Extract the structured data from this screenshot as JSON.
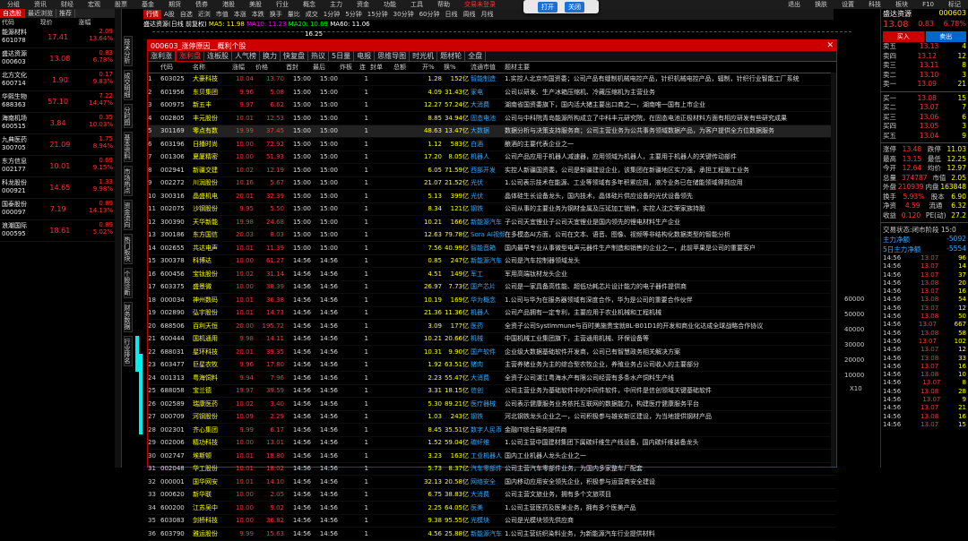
{
  "menubar": [
    "分组",
    "资讯",
    "财经",
    "宏观",
    "股票",
    "基金",
    "期货",
    "债券",
    "港股",
    "美股",
    "行业",
    "概念",
    "主力",
    "资金",
    "功能",
    "工具",
    "帮助"
  ],
  "menubar_alert": "交易未登录",
  "notify": {
    "open": "打开",
    "close": "关闭"
  },
  "top_right": [
    "退出",
    "换肤",
    "设置",
    "科技",
    "板块",
    "F10",
    "标记"
  ],
  "left": {
    "tabs": [
      "自选股",
      "最近浏览",
      "推荐"
    ],
    "header": [
      "代码",
      "现价",
      "涨幅"
    ],
    "rows": [
      {
        "name": "能源材料",
        "code": "601078",
        "price": "17.41",
        "chg": "2.09",
        "pct": "13.64%"
      },
      {
        "name": "盛达资源",
        "code": "000603",
        "price": "13.08",
        "chg": "0.83",
        "pct": "6.78%"
      },
      {
        "name": "北方文化",
        "code": "600714",
        "price": "1.90",
        "chg": "0.17",
        "pct": "9.83%"
      },
      {
        "name": "华熙生物",
        "code": "688363",
        "price": "57.10",
        "chg": "7.22",
        "pct": "14.47%"
      },
      {
        "name": "海南机场",
        "code": "600515",
        "price": "3.84",
        "chg": "0.35",
        "pct": "10.03%"
      },
      {
        "name": "九典医药",
        "code": "300705",
        "price": "21.09",
        "chg": "1.75",
        "pct": "8.94%"
      },
      {
        "name": "东方信息",
        "code": "002177",
        "price": "10.01",
        "chg": "0.69",
        "pct": "9.15%"
      },
      {
        "name": "科龙股份",
        "code": "000921",
        "price": "14.65",
        "chg": "1.33",
        "pct": "9.98%"
      },
      {
        "name": "国泰股份",
        "code": "000097",
        "price": "7.19",
        "chg": "0.89",
        "pct": "14.13%"
      },
      {
        "name": "浪潮国际",
        "code": "000595",
        "price": "18.61",
        "chg": "0.89",
        "pct": "5.02%"
      }
    ]
  },
  "vtabs": [
    "技术分析",
    "成交明细",
    "分时图",
    "基本资料",
    "市场热点",
    "资金流向",
    "热门板块",
    "个股诊断",
    "财务数据",
    "行业排名"
  ],
  "toolbar": [
    "行情",
    "A股",
    "自选",
    "近浏",
    "市值",
    "本涨",
    "本跌",
    "换手",
    "量比",
    "成交",
    "1分钟",
    "5分钟",
    "15分钟",
    "30分钟",
    "60分钟",
    "日线",
    "周线",
    "月线"
  ],
  "chartinfo": {
    "a": "盛达资源(日线 前复权)",
    "b": "MA5: 11.98",
    "c": "MA10: 11.23",
    "d": "MA20: 10.69",
    "e": "MA60: 11.06"
  },
  "priceline_label": "16.25",
  "axis_labels": [
    "60000",
    "50000",
    "40000",
    "30000",
    "20000",
    "10000"
  ],
  "axis_label_x10": "X10",
  "dialog": {
    "title": "000603_涨停原因__概利个股",
    "tabs": [
      "涨利涨",
      "涨利盘",
      "连板股",
      "人气榜",
      "换力",
      "快复盘",
      "热议",
      "5日量",
      "电报",
      "思维导图",
      "时光机",
      "题材轮",
      "全盘"
    ],
    "columns": [
      "代码",
      "名称",
      "涨幅",
      "价格",
      "首封",
      "最后",
      "炸板",
      "连",
      "封单",
      "总额",
      "开%",
      "换%",
      "流通市值",
      "题材主要"
    ],
    "rows": [
      {
        "no": "1",
        "code": "603025",
        "name": "大豪科技",
        "pct": "10.04",
        "price": "13.70",
        "t1": "15:00",
        "t2": "15:00",
        "zb": "",
        "lb": "1",
        "fd": "",
        "ze": "",
        "ok": "1.28",
        "hs": "152亿",
        "lt": "智能制造",
        "desc": "1.实控人北京市国资委；公司产品有缝制机械电控产品，针织机械电控产品，辐制，针织行业智能工厂系统"
      },
      {
        "no": "2",
        "code": "601956",
        "name": "东贝集团",
        "pct": "9.96",
        "price": "5.08",
        "t1": "15:00",
        "t2": "15:00",
        "zb": "",
        "lb": "1",
        "fd": "",
        "ze": "",
        "ok": "4.09",
        "hs": "31.43亿",
        "lt": "家电",
        "desc": "公司以研发、生产冰箱压缩机、冷藏压缩机为主营业务"
      },
      {
        "no": "3",
        "code": "600975",
        "name": "新五丰",
        "pct": "9.97",
        "price": "6.62",
        "t1": "15:00",
        "t2": "15:00",
        "zb": "",
        "lb": "1",
        "fd": "",
        "ze": "",
        "ok": "12.27",
        "hs": "57.24亿",
        "lt": "大消费",
        "desc": "湖南省国资委旗下，国内活大猪主要出口商之一，湖南唯一国有上市企业"
      },
      {
        "no": "4",
        "code": "002805",
        "name": "丰元股份",
        "pct": "10.01",
        "price": "12.53",
        "t1": "15:00",
        "t2": "15:00",
        "zb": "",
        "lb": "1",
        "fd": "",
        "ze": "",
        "ok": "8.85",
        "hs": "34.94亿",
        "lt": "固态电池",
        "desc": "公司与中科院青岛能源所构成立了中科丰元研究院，在固态电池正极材料方面有相应研发有些研究成果"
      },
      {
        "no": "5",
        "code": "301169",
        "name": "零点有数",
        "pct": "19.99",
        "price": "37.45",
        "t1": "15:00",
        "t2": "15:00",
        "zb": "",
        "lb": "1",
        "fd": "",
        "ze": "",
        "ok": "48.63",
        "hs": "13.47亿",
        "lt": "大数据",
        "desc": "数据分析与决策支持服务商；公司主营业务为公共事务领域数据产品，为客户提供全方位数据服务"
      },
      {
        "no": "6",
        "code": "603196",
        "name": "日播时尚",
        "pct": "10.00",
        "price": "72.92",
        "t1": "15:00",
        "t2": "15:00",
        "zb": "",
        "lb": "1",
        "fd": "",
        "ze": "",
        "ok": "1.12",
        "hs": "583亿",
        "lt": "白酒",
        "desc": "酿酒的主要代表企业之一"
      },
      {
        "no": "7",
        "code": "001306",
        "name": "夏厦精密",
        "pct": "10.00",
        "price": "51.93",
        "t1": "15:00",
        "t2": "15:00",
        "zb": "",
        "lb": "1",
        "fd": "",
        "ze": "",
        "ok": "17.20",
        "hs": "8.05亿",
        "lt": "机器人",
        "desc": "公司产品应用于机器人减速器，应用领域为机器人，主要用于机器人的关键传动部件"
      },
      {
        "no": "8",
        "code": "002941",
        "name": "新疆交建",
        "pct": "10.02",
        "price": "12.19",
        "t1": "15:00",
        "t2": "15:00",
        "zb": "",
        "lb": "1",
        "fd": "",
        "ze": "",
        "ok": "6.05",
        "hs": "71.59亿",
        "lt": "西部开发",
        "desc": "实控人新疆国资委，公司是新疆建设企业，该集团在新疆地区实力强，承担工程施工业务"
      },
      {
        "no": "9",
        "code": "002272",
        "name": "川润股份",
        "pct": "10.16",
        "price": "5.67",
        "t1": "15:00",
        "t2": "15:00",
        "zb": "",
        "lb": "1",
        "fd": "",
        "ze": "",
        "ok": "21.07",
        "hs": "21.52亿",
        "lt": "光伏",
        "desc": "1.公司表示技术在能源、工业等领域有多年积累应用，液冷业务已在储能领域得到应用"
      },
      {
        "no": "10",
        "code": "300316",
        "name": "晶盛机电",
        "pct": "20.01",
        "price": "32.39",
        "t1": "15:00",
        "t2": "15:00",
        "zb": "",
        "lb": "1",
        "fd": "",
        "ze": "",
        "ok": "5.13",
        "hs": "399亿",
        "lt": "光伏",
        "desc": "晶体硅生长设备龙头，国内技术，晶体硅片供应设备的光伏设备领先"
      },
      {
        "no": "11",
        "code": "002075",
        "name": "沙钢股份",
        "pct": "9.95",
        "price": "5.50",
        "t1": "15:00",
        "t2": "15:00",
        "zb": "",
        "lb": "1",
        "fd": "",
        "ze": "",
        "ok": "8.34",
        "hs": "121亿",
        "lt": "钢铁",
        "desc": "公司从事的主要业务为钢材金属及压延加工销售，实控人沈文荣家族持股"
      },
      {
        "no": "12",
        "code": "300390",
        "name": "天华新能",
        "pct": "19.98",
        "price": "24.68",
        "t1": "15:00",
        "t2": "15:00",
        "zb": "",
        "lb": "1",
        "fd": "",
        "ze": "",
        "ok": "10.21",
        "hs": "166亿",
        "lt": "新能源汽车",
        "desc": "子公司天宜锂业子公司天宜锂业是国内领先的锂电材料生产企业"
      },
      {
        "no": "13",
        "code": "300186",
        "name": "东方国信",
        "pct": "20.03",
        "price": "8.03",
        "t1": "15:00",
        "t2": "15:00",
        "zb": "",
        "lb": "1",
        "fd": "",
        "ze": "",
        "ok": "12.63",
        "hs": "79.78亿",
        "lt": "Sora AI视频",
        "desc": "在多模态AI方面，公司在文本、语音、图像、视频等非结构化数据类型的智能分析"
      },
      {
        "no": "14",
        "code": "002655",
        "name": "共达电声",
        "pct": "10.01",
        "price": "11.39",
        "t1": "15:00",
        "t2": "15:00",
        "zb": "",
        "lb": "1",
        "fd": "",
        "ze": "",
        "ok": "7.56",
        "hs": "40.99亿",
        "lt": "智能音箱",
        "desc": "国内最早专业从事微型电声元器件生产制造和销售的企业之一，此前苹果是公司的重要客户"
      },
      {
        "no": "15",
        "code": "300378",
        "name": "科博达",
        "pct": "10.00",
        "price": "61.27",
        "t1": "14:56",
        "t2": "14:56",
        "zb": "",
        "lb": "1",
        "fd": "",
        "ze": "",
        "ok": "0.85",
        "hs": "247亿",
        "lt": "新能源汽车",
        "desc": "公司是汽车控制器领域龙头"
      },
      {
        "no": "16",
        "code": "600456",
        "name": "宝钛股份",
        "pct": "10.02",
        "price": "31.14",
        "t1": "14:56",
        "t2": "14:56",
        "zb": "",
        "lb": "1",
        "fd": "",
        "ze": "",
        "ok": "4.51",
        "hs": "149亿",
        "lt": "军工",
        "desc": "军用高端钛材龙头企业"
      },
      {
        "no": "17",
        "code": "603375",
        "name": "盛景微",
        "pct": "10.00",
        "price": "38.39",
        "t1": "14:56",
        "t2": "14:56",
        "zb": "",
        "lb": "1",
        "fd": "",
        "ze": "",
        "ok": "26.97",
        "hs": "7.73亿",
        "lt": "国产芯片",
        "desc": "公司是一家具备高性能、超低功耗芯片设计能力的电子器件提供商"
      },
      {
        "no": "18",
        "code": "000034",
        "name": "神州数码",
        "pct": "10.01",
        "price": "36.38",
        "t1": "14:56",
        "t2": "14:56",
        "zb": "",
        "lb": "1",
        "fd": "",
        "ze": "",
        "ok": "10.19",
        "hs": "169亿",
        "lt": "华为概念",
        "desc": "1.公司与华为在服务器领域有深度合作，华为是公司的重要合作伙伴"
      },
      {
        "no": "19",
        "code": "002890",
        "name": "弘宇股份",
        "pct": "10.01",
        "price": "14.73",
        "t1": "14:56",
        "t2": "14:56",
        "zb": "",
        "lb": "1",
        "fd": "",
        "ze": "",
        "ok": "21.36",
        "hs": "11.36亿",
        "lt": "机器人",
        "desc": "公司产品拥有一定专利，主要应用于农业机械和工程机械"
      },
      {
        "no": "20",
        "code": "688506",
        "name": "百利天恒",
        "pct": "20.00",
        "price": "195.72",
        "t1": "14:56",
        "t2": "14:56",
        "zb": "",
        "lb": "1",
        "fd": "",
        "ze": "",
        "ok": "3.09",
        "hs": "177亿",
        "lt": "医药",
        "desc": "全资子公司SystImmune与百时美施贵宝就BL-B01D1的开发和商业化达成全球战略合作协议"
      },
      {
        "no": "21",
        "code": "600444",
        "name": "国机通用",
        "pct": "9.98",
        "price": "14.11",
        "t1": "14:56",
        "t2": "14:56",
        "zb": "",
        "lb": "1",
        "fd": "",
        "ze": "",
        "ok": "10.21",
        "hs": "20.66亿",
        "lt": "机械",
        "desc": "中国机械工业集团旗下，主营通用机械、环保设备等"
      },
      {
        "no": "22",
        "code": "688031",
        "name": "星环科技",
        "pct": "20.01",
        "price": "39.35",
        "t1": "14:56",
        "t2": "14:56",
        "zb": "",
        "lb": "1",
        "fd": "",
        "ze": "",
        "ok": "10.31",
        "hs": "9.90亿",
        "lt": "国产软件",
        "desc": "企业级大数据基础软件开发商，公司已有智慧政务相关解决方案"
      },
      {
        "no": "23",
        "code": "603477",
        "name": "巨星农牧",
        "pct": "9.96",
        "price": "17.80",
        "t1": "14:56",
        "t2": "14:56",
        "zb": "",
        "lb": "1",
        "fd": "",
        "ze": "",
        "ok": "1.92",
        "hs": "63.51亿",
        "lt": "猪肉",
        "desc": "主营养猪业务为主的综合型农牧企业，养殖业务占公司收入的主要部分"
      },
      {
        "no": "24",
        "code": "001313",
        "name": "粤海饲料",
        "pct": "9.94",
        "price": "7.96",
        "t1": "14:56",
        "t2": "14:56",
        "zb": "",
        "lb": "1",
        "fd": "",
        "ze": "",
        "ok": "2.23",
        "hs": "55.47亿",
        "lt": "大消费",
        "desc": "全资子公司湛江粤海水产有限公司经营有多条水产饲料生产线"
      },
      {
        "no": "25",
        "code": "688058",
        "name": "宝兰德",
        "pct": "19.97",
        "price": "39.59",
        "t1": "14:56",
        "t2": "14:56",
        "zb": "",
        "lb": "1",
        "fd": "",
        "ze": "",
        "ok": "3.31",
        "hs": "18.15亿",
        "lt": "信创",
        "desc": "公司主营业务为基础软件中的中间件软件，中间件是信创领域关键基础软件"
      },
      {
        "no": "26",
        "code": "002589",
        "name": "瑞康医药",
        "pct": "10.02",
        "price": "3.40",
        "t1": "14:56",
        "t2": "14:56",
        "zb": "",
        "lb": "1",
        "fd": "",
        "ze": "",
        "ok": "5.30",
        "hs": "89.21亿",
        "lt": "医疗器械",
        "desc": "公司表示健康服务业务依托互联网的数据能力，构建医疗健康服务平台"
      },
      {
        "no": "27",
        "code": "000709",
        "name": "河钢股份",
        "pct": "10.09",
        "price": "2.29",
        "t1": "14:56",
        "t2": "14:56",
        "zb": "",
        "lb": "1",
        "fd": "",
        "ze": "",
        "ok": "1.03",
        "hs": "243亿",
        "lt": "钢铁",
        "desc": "河北钢铁龙头企业之一，公司积极参与雄安新区建设，为当地提供钢材产品"
      },
      {
        "no": "28",
        "code": "002301",
        "name": "齐心集团",
        "pct": "9.99",
        "price": "6.17",
        "t1": "14:56",
        "t2": "14:56",
        "zb": "",
        "lb": "1",
        "fd": "",
        "ze": "",
        "ok": "8.45",
        "hs": "35.51亿",
        "lt": "数字人民币",
        "desc": "金融IT综合服务提供商"
      },
      {
        "no": "29",
        "code": "002006",
        "name": "精功科技",
        "pct": "10.00",
        "price": "13.01",
        "t1": "14:56",
        "t2": "14:56",
        "zb": "",
        "lb": "1",
        "fd": "",
        "ze": "",
        "ok": "1.52",
        "hs": "59.04亿",
        "lt": "碳纤维",
        "desc": "1.公司主营中国建材集团下属碳纤维生产线设备，国内碳纤维装备龙头"
      },
      {
        "no": "30",
        "code": "002747",
        "name": "埃斯顿",
        "pct": "10.01",
        "price": "18.80",
        "t1": "14:56",
        "t2": "14:56",
        "zb": "",
        "lb": "1",
        "fd": "",
        "ze": "",
        "ok": "3.23",
        "hs": "163亿",
        "lt": "工业机器人",
        "desc": "国内工业机器人龙头企业之一"
      },
      {
        "no": "31",
        "code": "002048",
        "name": "华工股份",
        "pct": "10.01",
        "price": "18.02",
        "t1": "14:56",
        "t2": "14:56",
        "zb": "",
        "lb": "1",
        "fd": "",
        "ze": "",
        "ok": "5.73",
        "hs": "8.37亿",
        "lt": "汽车零部件",
        "desc": "公司主营汽车零部件业务，为国内多家整车厂配套"
      },
      {
        "no": "32",
        "code": "000001",
        "name": "国华网安",
        "pct": "10.01",
        "price": "14.10",
        "t1": "14:56",
        "t2": "14:56",
        "zb": "",
        "lb": "1",
        "fd": "",
        "ze": "",
        "ok": "32.13",
        "hs": "20.58亿",
        "lt": "网络安全",
        "desc": "国内移动应用安全领先企业，积极参与运营商安全建设"
      },
      {
        "no": "33",
        "code": "000620",
        "name": "新华联",
        "pct": "10.00",
        "price": "2.05",
        "t1": "14:56",
        "t2": "14:56",
        "zb": "",
        "lb": "1",
        "fd": "",
        "ze": "",
        "ok": "6.75",
        "hs": "38.83亿",
        "lt": "大消费",
        "desc": "公司主营文旅业务，拥有多个文旅项目"
      },
      {
        "no": "34",
        "code": "600200",
        "name": "江苏吴中",
        "pct": "10.00",
        "price": "9.02",
        "t1": "14:56",
        "t2": "14:56",
        "zb": "",
        "lb": "1",
        "fd": "",
        "ze": "",
        "ok": "2.25",
        "hs": "64.05亿",
        "lt": "医美",
        "desc": "1.公司主营医药及医美业务，拥有多个医美产品"
      },
      {
        "no": "35",
        "code": "603083",
        "name": "剑桥科技",
        "pct": "10.00",
        "price": "36.82",
        "t1": "14:56",
        "t2": "14:56",
        "zb": "",
        "lb": "1",
        "fd": "",
        "ze": "",
        "ok": "9.38",
        "hs": "95.55亿",
        "lt": "光模块",
        "desc": "公司是光模块领先供应商"
      },
      {
        "no": "36",
        "code": "603790",
        "name": "雅运股份",
        "pct": "9.99",
        "price": "15.63",
        "t1": "14:56",
        "t2": "14:56",
        "zb": "",
        "lb": "1",
        "fd": "",
        "ze": "",
        "ok": "4.56",
        "hs": "25.88亿",
        "lt": "新能源汽车",
        "desc": "1.公司主营纺织染料业务，为新能源汽车行业提供材料"
      }
    ]
  },
  "right": {
    "name": "盛达资源",
    "code": "000603",
    "price": "13.08",
    "chg": "0.83",
    "pct": "6.78%",
    "buy": "买入",
    "sell": "卖出",
    "asks": [
      {
        "l": "卖五",
        "p": "13.13",
        "v": "4"
      },
      {
        "l": "卖四",
        "p": "13.12",
        "v": "12"
      },
      {
        "l": "卖三",
        "p": "13.11",
        "v": "8"
      },
      {
        "l": "卖二",
        "p": "13.10",
        "v": "3"
      },
      {
        "l": "卖一",
        "p": "13.09",
        "v": "21"
      }
    ],
    "bids": [
      {
        "l": "买一",
        "p": "13.08",
        "v": "15"
      },
      {
        "l": "买二",
        "p": "13.07",
        "v": "7"
      },
      {
        "l": "买三",
        "p": "13.06",
        "v": "6"
      },
      {
        "l": "买四",
        "p": "13.05",
        "v": "3"
      },
      {
        "l": "买五",
        "p": "13.04",
        "v": "9"
      }
    ],
    "stats": [
      [
        "涨停",
        "13.48",
        "跌停",
        "11.03"
      ],
      [
        "最高",
        "13.15",
        "最低",
        "12.25"
      ],
      [
        "今开",
        "12.64",
        "均价",
        "12.97"
      ],
      [
        "总量",
        "374787",
        "市值",
        "2.05"
      ],
      [
        "外盘",
        "210939",
        "内盘",
        "163848"
      ],
      [
        "换手",
        "5.93%",
        "股本",
        "6.90"
      ],
      [
        "净资",
        "4.59",
        "流通",
        "6.32"
      ],
      [
        "收益",
        "0.120",
        "PE(动)",
        "27.2"
      ]
    ],
    "trade_status": "交易状态:闭市阶段 15:0",
    "flow1": {
      "label": "主力净额",
      "val": "-5092"
    },
    "flow5": {
      "label": "5日主力净额",
      "val": "-5554"
    },
    "ticks": [
      {
        "t": "14:56",
        "p": "13.07",
        "v": "96"
      },
      {
        "t": "14:56",
        "p": "13.07",
        "v": "14"
      },
      {
        "t": "14:56",
        "p": "13.07",
        "v": "37"
      },
      {
        "t": "14:56",
        "p": "13.08",
        "v": "20"
      },
      {
        "t": "14:56",
        "p": "13.07",
        "v": "16"
      },
      {
        "t": "14:56",
        "p": "13.08",
        "v": "54"
      },
      {
        "t": "14:56",
        "p": "13.07",
        "v": "12"
      },
      {
        "t": "14:56",
        "p": "13.08",
        "v": "50"
      },
      {
        "t": "14:56",
        "p": "13.07",
        "v": "667"
      },
      {
        "t": "14:56",
        "p": "13.08",
        "v": "58"
      },
      {
        "t": "14:56",
        "p": "13.07",
        "v": "102"
      },
      {
        "t": "14:56",
        "p": "13.07",
        "v": "12"
      },
      {
        "t": "14:56",
        "p": "13.08",
        "v": "33"
      },
      {
        "t": "14:56",
        "p": "13.07",
        "v": "16"
      },
      {
        "t": "14:56",
        "p": "13.08",
        "v": "10"
      },
      {
        "t": "14:56",
        "p": "13.07",
        "v": "8"
      },
      {
        "t": "14:56",
        "p": "13.08",
        "v": "28"
      },
      {
        "t": "14:56",
        "p": "13.07",
        "v": "9"
      },
      {
        "t": "14:56",
        "p": "13.07",
        "v": "21"
      },
      {
        "t": "14:56",
        "p": "13.08",
        "v": "16"
      },
      {
        "t": "14:56",
        "p": "13.07",
        "v": "15"
      }
    ]
  }
}
